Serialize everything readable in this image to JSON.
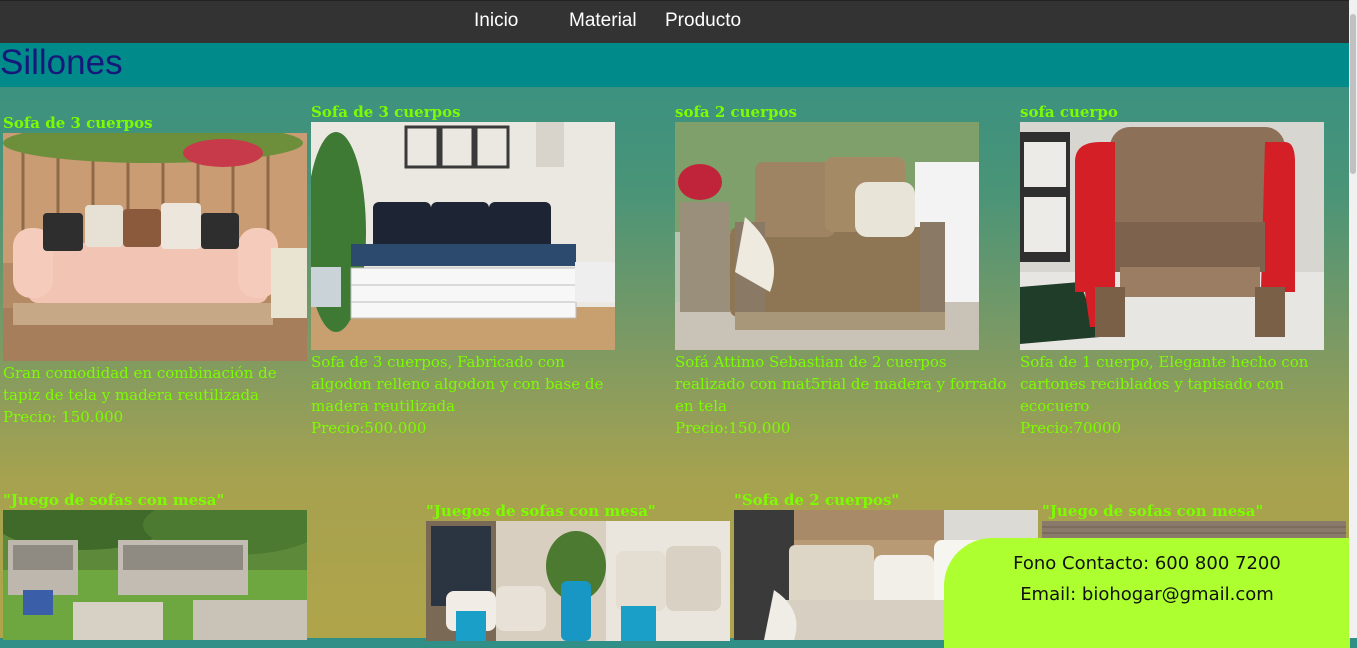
{
  "nav": {
    "items": [
      {
        "label": "Inicio"
      },
      {
        "label": "Material"
      },
      {
        "label": "Producto"
      }
    ]
  },
  "page": {
    "title": "Sillones"
  },
  "products": [
    {
      "title": "Sofa de 3 cuerpos",
      "desc": "Gran comodidad en combinación de tapiz de tela y madera reutilizada",
      "price": "Precio: 150.000",
      "image": "pink-pallet-sofa-photo"
    },
    {
      "title": "Sofa de 3 cuerpos",
      "desc": "Sofa de 3 cuerpos, Fabricado con algodon relleno algodon y con base de madera reutilizada",
      "price": "Precio:500.000",
      "image": "white-pallet-sofa-photo"
    },
    {
      "title": "sofa 2 cuerpos",
      "desc": "Sofá Attimo Sebastian de 2 cuerpos realizado con mat5rial de madera y forrado en tela",
      "price": "Precio:150.000",
      "image": "burlap-armchair-photo"
    },
    {
      "title": "sofa cuerpo",
      "desc": "Sofa de 1 cuerpo, Elegante hecho con cartones reciblados y tapisado con ecocuero",
      "price": "Precio:70000",
      "image": "cardboard-armchair-photo"
    },
    {
      "title": "\"Juego de sofas con mesa\"",
      "image": "garden-pallet-set-photo"
    },
    {
      "title": "\"Juegos de sofas con mesa\"",
      "image": "cushions-pallet-set-photo"
    },
    {
      "title": "\"Sofa de 2 cuerpos\"",
      "image": "wood-sofa-photo"
    },
    {
      "title": "\"Juego de sofas con mesa\"",
      "image": "brick-wall-set-photo"
    }
  ],
  "contact": {
    "phone": "Fono Contacto: 600 800 7200",
    "email": "Email: biohogar@gmail.com"
  },
  "colors": {
    "topbar": "#333333",
    "title_band": "#008b8a",
    "title_text": "#16187a",
    "product_text": "#7cfc00",
    "contact_bg": "#adff2f"
  }
}
